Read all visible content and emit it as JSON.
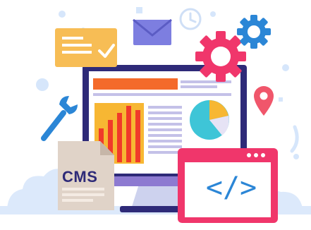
{
  "illustration": {
    "cms_label": "CMS",
    "code_label": "</>",
    "icons": [
      "envelope-icon",
      "clock-icon",
      "gear-icon",
      "gear-small-icon",
      "wrench-icon",
      "map-pin-icon",
      "check-icon",
      "pie-chart-icon",
      "bar-chart-icon",
      "code-icon",
      "document-icon"
    ],
    "colors": {
      "navy": "#2e2a78",
      "pink": "#f0366b",
      "blue": "#2b86d6",
      "yellow": "#f7b733",
      "orange": "#f46a2a",
      "red": "#f03a2a",
      "cyan": "#3ec5d7",
      "lavender": "#c4c1e8",
      "pale_blue": "#dce9fb",
      "card_yellow": "#f7bd55",
      "doc_beige": "#e0d3c8"
    }
  }
}
